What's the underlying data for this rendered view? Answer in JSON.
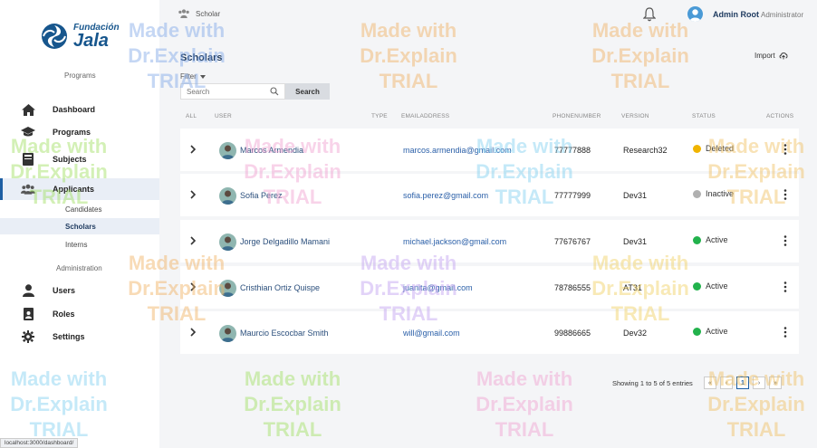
{
  "sidebar": {
    "logo_small": "Fundación",
    "logo_big": "Jala",
    "programs_label": "Programs",
    "admin_label": "Administration",
    "items": [
      {
        "label": "Dashboard",
        "icon": "home-icon"
      },
      {
        "label": "Programs",
        "icon": "graduation-cap-icon"
      },
      {
        "label": "Subjects",
        "icon": "book-icon"
      },
      {
        "label": "Applicants",
        "icon": "users-icon",
        "active": true
      }
    ],
    "sub_items": [
      {
        "label": "Candidates"
      },
      {
        "label": "Scholars",
        "active": true
      },
      {
        "label": "Interns"
      }
    ],
    "admin_items": [
      {
        "label": "Users",
        "icon": "user-icon"
      },
      {
        "label": "Roles",
        "icon": "id-badge-icon"
      },
      {
        "label": "Settings",
        "icon": "gear-icon"
      }
    ]
  },
  "topbar": {
    "breadcrumb": "Scholar",
    "user_name": "Admin Root",
    "user_role": "Administrator"
  },
  "main": {
    "title": "Scholars",
    "import_label": "Import",
    "filter_label": "Filter",
    "search_placeholder": "Search",
    "search_button": "Search",
    "columns": [
      "ALL",
      "USER",
      "TYPE",
      "EMAILADDRESS",
      "PHONENUMBER",
      "VERSION",
      "STATUS",
      "ACTIONS"
    ],
    "rows": [
      {
        "name": "Marcos Armendia",
        "email": "marcos.armendia@gmail.com",
        "phone": "77777888",
        "version": "Research32",
        "status": "Deleted",
        "status_color": "#f0b400"
      },
      {
        "name": "Sofia Perez",
        "email": "sofia.perez@gmail.com",
        "phone": "77777999",
        "version": "Dev31",
        "status": "Inactive",
        "status_color": "#b0b0b0"
      },
      {
        "name": "Jorge Delgadillo Mamani",
        "email": "michael.jackson@gmail.com",
        "phone": "77676767",
        "version": "Dev31",
        "status": "Active",
        "status_color": "#22b24c"
      },
      {
        "name": "Cristhian Ortiz Quispe",
        "email": "juanita@gmail.com",
        "phone": "78786555",
        "version": "AT31",
        "status": "Active",
        "status_color": "#22b24c"
      },
      {
        "name": "Maurcio Escocbar Smith",
        "email": "will@gmail.com",
        "phone": "99886665",
        "version": "Dev32",
        "status": "Active",
        "status_color": "#22b24c"
      }
    ],
    "showing": "Showing 1 to 5 of 5 entries",
    "pages": [
      "«",
      "‹",
      "1",
      "›",
      "»"
    ]
  },
  "status_url": "localhost:3000/dashboard/",
  "watermark": {
    "line1": "Made with",
    "line2": "Dr.Explain",
    "line3": "TRIAL"
  }
}
